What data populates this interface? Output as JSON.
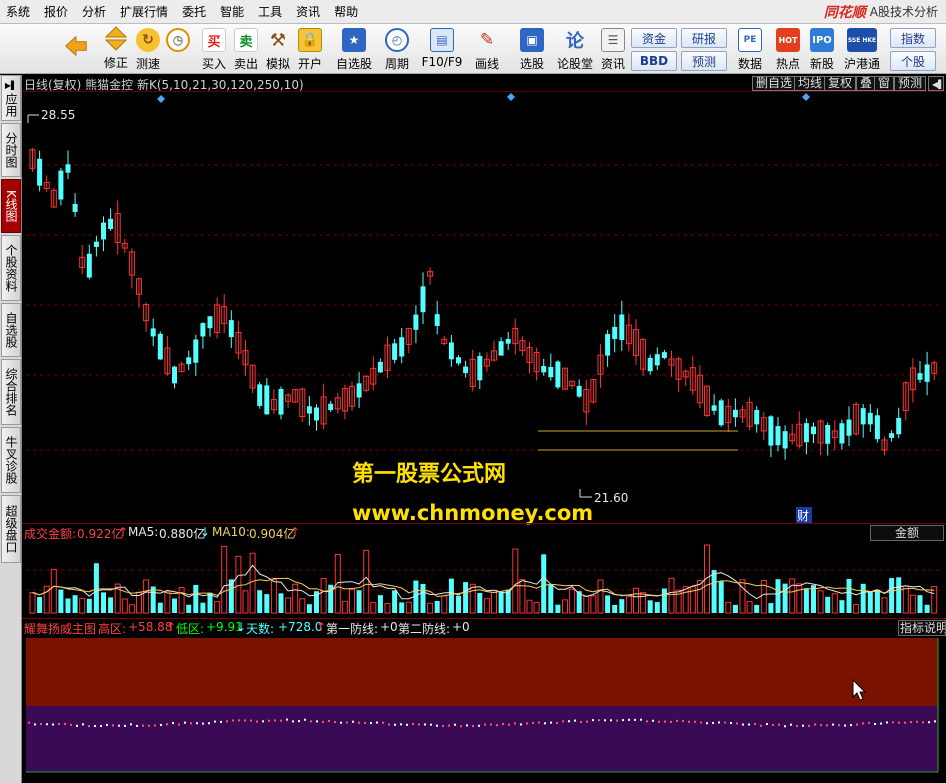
{
  "menu": [
    "系统",
    "报价",
    "分析",
    "扩展行情",
    "委托",
    "智能",
    "工具",
    "资讯",
    "帮助"
  ],
  "brand": {
    "logo": "同花顺",
    "subtitle": "A股技术分析"
  },
  "toolbar": {
    "buttons": [
      {
        "name": "color-block-button",
        "label": ""
      },
      {
        "name": "back-button",
        "label": ""
      },
      {
        "name": "revise-button",
        "label": "修正"
      },
      {
        "name": "speed-test-button",
        "label": "测速"
      },
      {
        "name": "buy-button",
        "label": "买入",
        "icon_text": "买"
      },
      {
        "name": "sell-button",
        "label": "卖出",
        "icon_text": "卖"
      },
      {
        "name": "simulate-button",
        "label": "模拟"
      },
      {
        "name": "open-account-button",
        "label": "开户"
      },
      {
        "name": "watchlist-button",
        "label": "自选股"
      },
      {
        "name": "period-button",
        "label": "周期"
      },
      {
        "name": "f10-button",
        "label": "F10/F9"
      },
      {
        "name": "drawline-button",
        "label": "画线"
      },
      {
        "name": "stock-picker-button",
        "label": "选股"
      },
      {
        "name": "forum-button",
        "label": "论股堂",
        "icon_text": "论"
      },
      {
        "name": "news-button",
        "label": "资讯"
      },
      {
        "name": "data-button",
        "label": "数据",
        "icon_text": "PE"
      },
      {
        "name": "hot-button",
        "label": "热点",
        "icon_text": "HOT"
      },
      {
        "name": "new-stock-button",
        "label": "新股"
      },
      {
        "name": "hk-connect-button",
        "label": "沪港通",
        "icon_text": "SSE HKE"
      }
    ],
    "small_buttons": {
      "fund": "资金",
      "bbd": "BBD",
      "research": "研报",
      "forecast": "预测",
      "index": "指数",
      "stock": "个股"
    }
  },
  "left_tabs": [
    "应用",
    "分时图",
    "K线图",
    "个股资料",
    "自选股",
    "综合排名",
    "牛叉诊股",
    "超级盘口"
  ],
  "chart": {
    "title": "日线(复权)  熊猫金控  新K(5,10,21,30,120,250,10)",
    "header_buttons": [
      "删自选",
      "均线",
      "复权",
      "叠",
      "窗",
      "预测"
    ],
    "high_label": "28.55",
    "low_label": "21.60",
    "finance_badge": "财",
    "watermark_cn": "第一股票公式网",
    "watermark_url": "www.chnmoney.com",
    "colors": {
      "up": "#ff3232",
      "down": "#54ffff",
      "grid": "#7a0000"
    }
  },
  "volume": {
    "label": "成交金额:",
    "value": "0.922亿",
    "ma5_label": "MA5:",
    "ma5": "0.880亿",
    "ma10_label": "MA10:",
    "ma10": "0.904亿",
    "right_box": "金额"
  },
  "indicator": {
    "name": "耀舞扬威主图",
    "high_label": "高区:",
    "high_val": "+58.88",
    "low_label": "低区:",
    "low_val": "+9.91",
    "days_label": "天数:",
    "days_val": "+728.0",
    "line1_label": "第一防线:",
    "line1_val": "+0",
    "line2_label": "第二防线:",
    "line2_val": "+0",
    "help_button": "指标说明",
    "colors": {
      "upper_band": "#7a1200",
      "lower_band": "#3a0a56"
    }
  }
}
